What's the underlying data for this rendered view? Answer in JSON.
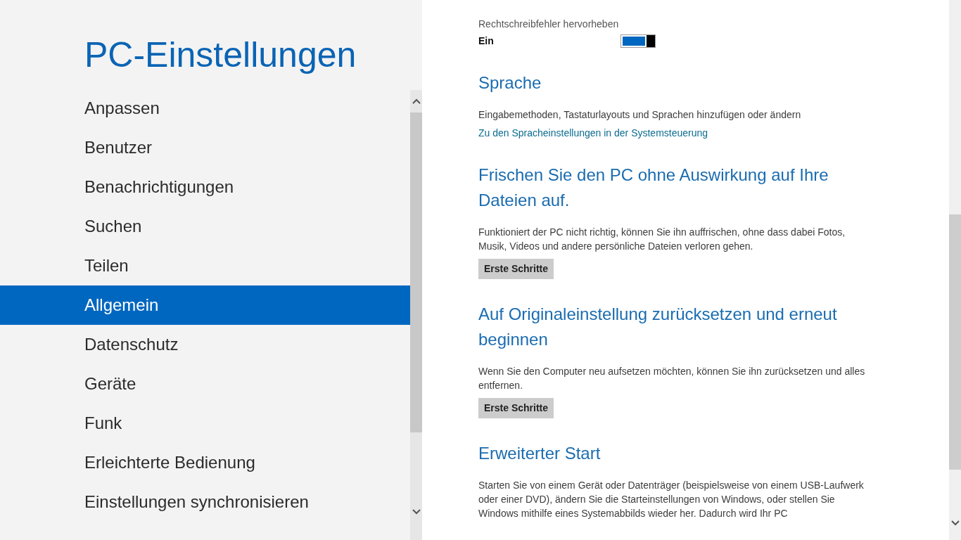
{
  "sidebar": {
    "title": "PC-Einstellungen",
    "items": [
      {
        "label": "Anpassen",
        "selected": false
      },
      {
        "label": "Benutzer",
        "selected": false
      },
      {
        "label": "Benachrichtigungen",
        "selected": false
      },
      {
        "label": "Suchen",
        "selected": false
      },
      {
        "label": "Teilen",
        "selected": false
      },
      {
        "label": "Allgemein",
        "selected": true
      },
      {
        "label": "Datenschutz",
        "selected": false
      },
      {
        "label": "Geräte",
        "selected": false
      },
      {
        "label": "Funk",
        "selected": false
      },
      {
        "label": "Erleichterte Bedienung",
        "selected": false
      },
      {
        "label": "Einstellungen synchronisieren",
        "selected": false
      }
    ]
  },
  "toggle": {
    "label": "Rechtschreibfehler hervorheben",
    "value": "Ein",
    "on": true
  },
  "sections": [
    {
      "heading": "Sprache",
      "description": "Eingabemethoden, Tastaturlayouts und Sprachen hinzufügen oder ändern",
      "link": "Zu den Spracheinstellungen in der Systemsteuerung"
    },
    {
      "heading": "Frischen Sie den PC ohne Auswirkung auf Ihre Dateien auf.",
      "description": "Funktioniert der PC nicht richtig, können Sie ihn auffrischen, ohne dass dabei Fotos, Musik, Videos und andere persönliche Dateien verloren gehen.",
      "button": "Erste Schritte"
    },
    {
      "heading": "Auf Originaleinstellung zurücksetzen und erneut beginnen",
      "description": "Wenn Sie den Computer neu aufsetzen möchten, können Sie ihn zurücksetzen und alles entfernen.",
      "button": "Erste Schritte"
    },
    {
      "heading": "Erweiterter Start",
      "description": "Starten Sie von einem Gerät oder Datenträger (beispielsweise von einem USB-Laufwerk oder einer DVD), ändern Sie die Starteinstellungen von Windows, oder stellen Sie Windows mithilfe eines Systemabbilds wieder her. Dadurch wird Ihr PC"
    }
  ]
}
